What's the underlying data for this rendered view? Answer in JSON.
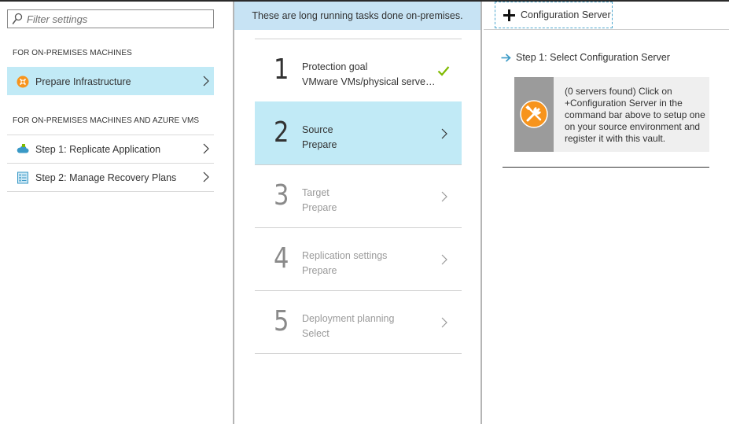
{
  "filter": {
    "placeholder": "Filter settings",
    "value": ""
  },
  "left_nav": {
    "sections": [
      {
        "header": "FOR ON-PREMISES MACHINES",
        "items": [
          {
            "label": "Prepare Infrastructure",
            "icon": "prepare-infrastructure-icon",
            "selected": true
          }
        ]
      },
      {
        "header": "FOR ON-PREMISES MACHINES AND AZURE VMS",
        "items": [
          {
            "label": "Step 1: Replicate Application",
            "icon": "cloud-replicate-icon",
            "selected": false
          },
          {
            "label": "Step 2: Manage Recovery Plans",
            "icon": "recovery-plan-icon",
            "selected": false
          }
        ]
      }
    ]
  },
  "middle": {
    "banner": "These are long running tasks done on-premises.",
    "steps": [
      {
        "number": "1",
        "title": "Protection goal",
        "subtitle": "VMware VMs/physical servers ...",
        "status": "completed"
      },
      {
        "number": "2",
        "title": "Source",
        "subtitle": "Prepare",
        "status": "selected"
      },
      {
        "number": "3",
        "title": "Target",
        "subtitle": "Prepare",
        "status": "disabled"
      },
      {
        "number": "4",
        "title": "Replication settings",
        "subtitle": "Prepare",
        "status": "disabled"
      },
      {
        "number": "5",
        "title": "Deployment planning",
        "subtitle": "Select",
        "status": "disabled"
      }
    ]
  },
  "right": {
    "command_button": "Configuration Server",
    "step_label": "Step 1: Select Configuration Server",
    "info_card_text": "(0 servers found) Click on +Configuration Server in the command bar above to setup one on your source environment and register it with this vault."
  },
  "colors": {
    "selected_bg": "#c1eaf6",
    "banner_bg": "#c7e3f4",
    "check_green": "#7fba00",
    "accent_orange": "#f7941d",
    "arrow_blue": "#3999c6"
  }
}
